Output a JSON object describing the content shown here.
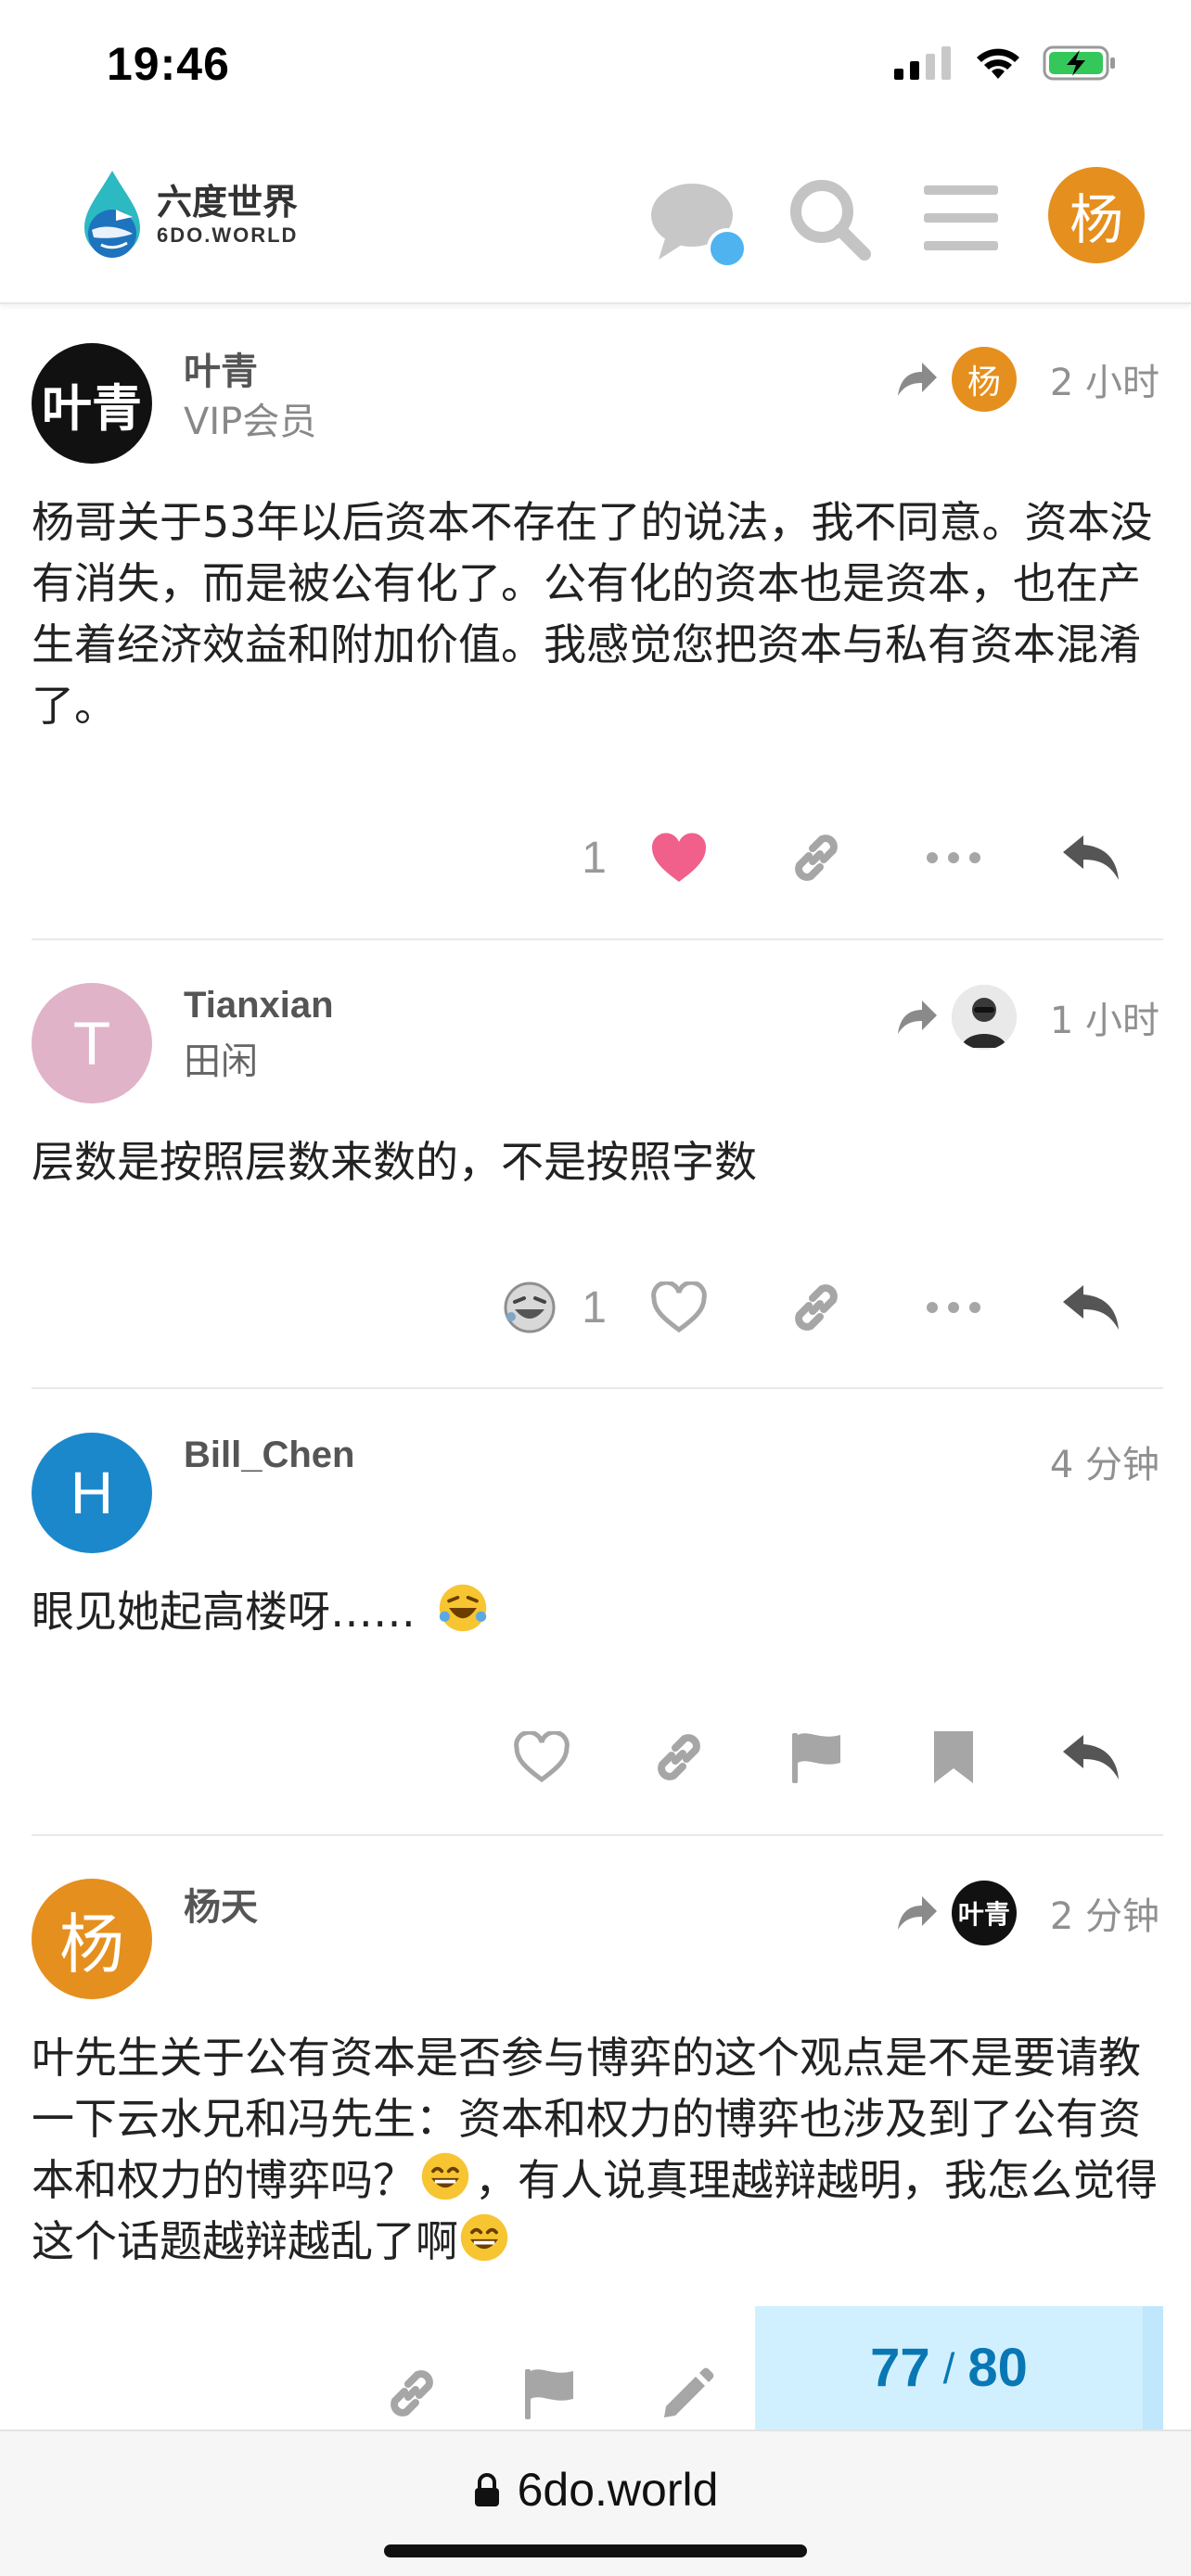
{
  "status_bar": {
    "time": "19:46"
  },
  "header": {
    "logo_cn": "六度世界",
    "logo_en": "6DO.WORLD",
    "user_avatar_letter": "杨"
  },
  "posts": [
    {
      "username": "叶青",
      "subtitle": "VIP会员",
      "avatar_text": "叶青",
      "reply_to_avatar": "杨",
      "time": "2 小时",
      "body": "杨哥关于53年以后资本不存在了的说法，我不同意。资本没有消失，而是被公有化了。公有化的资本也是资本，也在产生着经济效益和附加价值。我感觉您把资本与私有资本混淆了。",
      "like_count": "1"
    },
    {
      "username": "Tianxian",
      "subtitle": "田闲",
      "avatar_text": "T",
      "time": "1 小时",
      "body": "层数是按照层数来数的，不是按照字数",
      "reaction_count": "1"
    },
    {
      "username": "Bill_Chen",
      "avatar_text": "H",
      "time": "4 分钟",
      "body": "眼见她起高楼呀……"
    },
    {
      "username": "杨天",
      "avatar_text": "杨",
      "reply_to_avatar": "叶青",
      "time": "2 分钟",
      "body_part1": "叶先生关于公有资本是否参与博弈的这个观点是不是要请教一下云水兄和冯先生：资本和权力的博弈也涉及到了公有资本和权力的博弈吗？",
      "body_part2": "，有人说真理越辩越明，我怎么觉得这个话题越辩越乱了啊"
    }
  ],
  "progress": {
    "current": "77",
    "separator": "/",
    "total": "80"
  },
  "bottom_bar": {
    "url": "6do.world"
  },
  "colors": {
    "accent_orange": "#e58f1e",
    "heart_pink": "#f0608a",
    "progress_bg": "#d1f0ff",
    "progress_text": "#0a77b5",
    "icon_gray": "#9a9a9a"
  }
}
